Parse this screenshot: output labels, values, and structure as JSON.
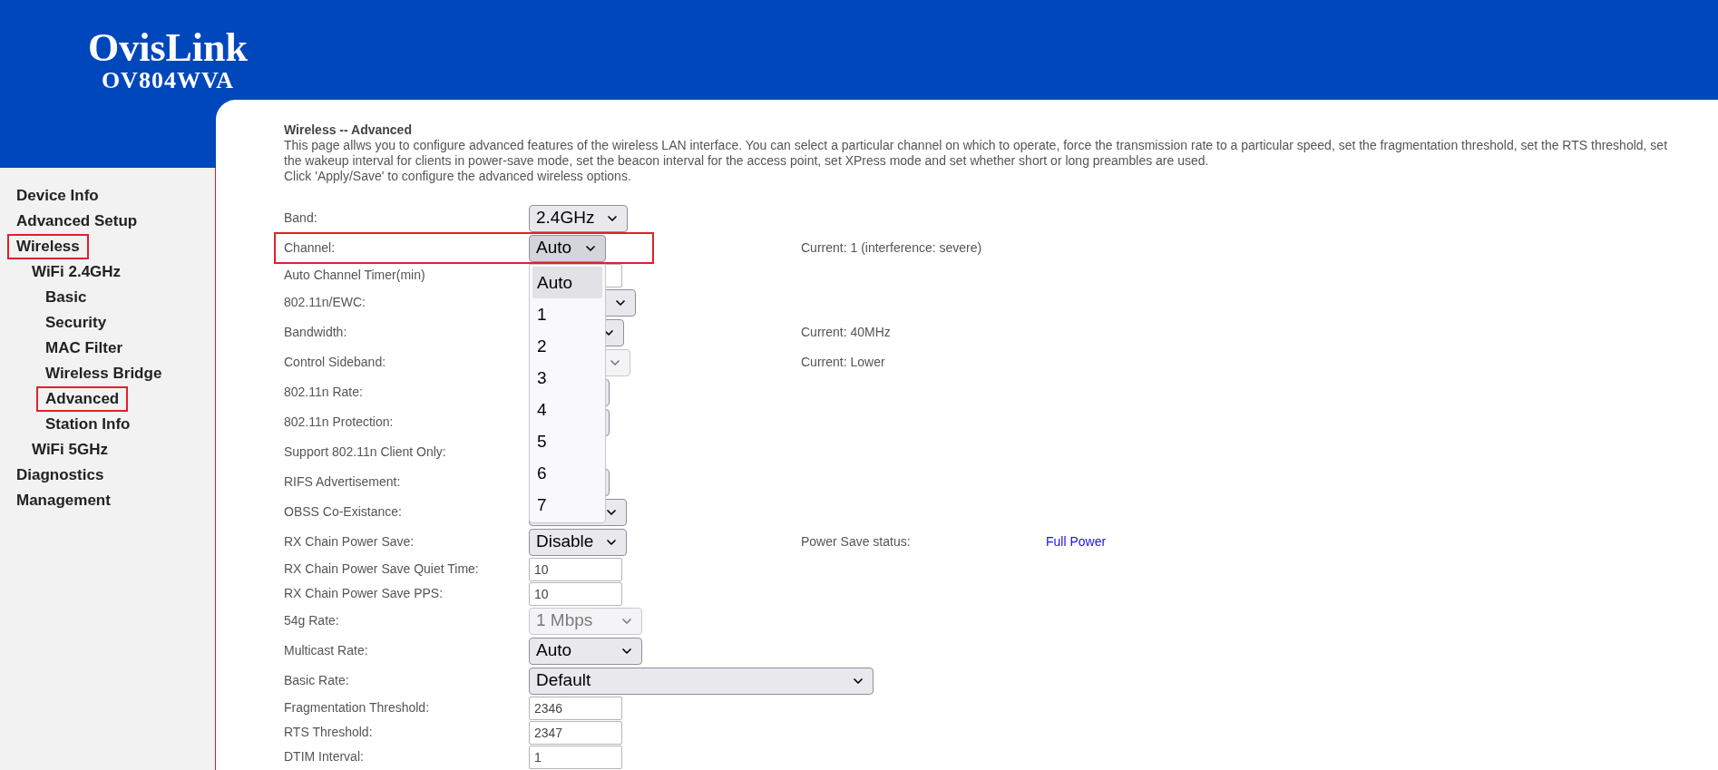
{
  "logo": {
    "brand": "OvisLink",
    "model": "OV804WVA"
  },
  "sidebar": {
    "items": [
      {
        "label": "Device Info",
        "highlighted": false
      },
      {
        "label": "Advanced Setup",
        "highlighted": false
      },
      {
        "label": "Wireless",
        "highlighted": true,
        "children": [
          {
            "label": "WiFi 2.4GHz",
            "highlighted": false,
            "children": [
              {
                "label": "Basic",
                "highlighted": false
              },
              {
                "label": "Security",
                "highlighted": false
              },
              {
                "label": "MAC Filter",
                "highlighted": false
              },
              {
                "label": "Wireless Bridge",
                "highlighted": false
              },
              {
                "label": "Advanced",
                "highlighted": true
              },
              {
                "label": "Station Info",
                "highlighted": false
              }
            ]
          },
          {
            "label": "WiFi 5GHz",
            "highlighted": false
          }
        ]
      },
      {
        "label": "Diagnostics",
        "highlighted": false
      },
      {
        "label": "Management",
        "highlighted": false
      }
    ]
  },
  "page": {
    "title": "Wireless -- Advanced",
    "description": "This page allws you to configure advanced features of the wireless LAN interface. You can select a particular channel on which to operate, force the transmission rate to a particular speed, set the fragmentation threshold, set the RTS threshold, set the wakeup interval for clients in power-save mode, set the beacon interval for the access point, set XPress mode and set whether short or long preambles are used.",
    "instruction": "Click 'Apply/Save' to configure the advanced wireless options."
  },
  "form": {
    "rows": [
      {
        "label": "Band:",
        "highlighted": false,
        "control": {
          "kind": "select",
          "value": "2.4GHz",
          "disabled": false
        }
      },
      {
        "label": "Channel:",
        "highlighted": true,
        "control": {
          "kind": "select",
          "value": "Auto",
          "disabled": false,
          "open": true,
          "options": [
            {
              "label": "Auto",
              "selected": true
            },
            {
              "label": "1",
              "selected": false
            },
            {
              "label": "2",
              "selected": false
            },
            {
              "label": "3",
              "selected": false
            },
            {
              "label": "4",
              "selected": false
            },
            {
              "label": "5",
              "selected": false
            },
            {
              "label": "6",
              "selected": false
            },
            {
              "label": "7",
              "selected": false
            }
          ]
        },
        "status": "Current: 1 (interference: severe)"
      },
      {
        "label": "Auto Channel Timer(min)",
        "highlighted": false,
        "control": {
          "kind": "input"
        }
      },
      {
        "label": "802.11n/EWC:",
        "highlighted": false,
        "control": {
          "kind": "select",
          "disabled": false
        }
      },
      {
        "label": "Bandwidth:",
        "highlighted": false,
        "control": {
          "kind": "select",
          "disabled": false
        },
        "status": "Current: 40MHz"
      },
      {
        "label": "Control Sideband:",
        "highlighted": false,
        "control": {
          "kind": "select",
          "disabled": true
        },
        "status": "Current: Lower"
      },
      {
        "label": "802.11n Rate:",
        "highlighted": false,
        "control": {
          "kind": "select"
        }
      },
      {
        "label": "802.11n Protection:",
        "highlighted": false,
        "control": {
          "kind": "select"
        }
      },
      {
        "label": "Support 802.11n Client Only:",
        "highlighted": false
      },
      {
        "label": "RIFS Advertisement:",
        "highlighted": false,
        "control": {
          "kind": "select"
        }
      },
      {
        "label": "OBSS Co-Existance:",
        "highlighted": false,
        "control": {
          "kind": "select",
          "disabled": false
        }
      },
      {
        "label": "RX Chain Power Save:",
        "highlighted": false,
        "control": {
          "kind": "select",
          "value": "Disable",
          "disabled": false
        },
        "status": "Power Save status:",
        "status_value": "Full Power"
      },
      {
        "label": "RX Chain Power Save Quiet Time:",
        "highlighted": false,
        "control": {
          "kind": "input",
          "value": "10"
        }
      },
      {
        "label": "RX Chain Power Save PPS:",
        "highlighted": false,
        "control": {
          "kind": "input",
          "value": "10"
        }
      },
      {
        "label": "54g Rate:",
        "highlighted": false,
        "control": {
          "kind": "select",
          "value": "1 Mbps",
          "disabled": true
        }
      },
      {
        "label": "Multicast Rate:",
        "highlighted": false,
        "control": {
          "kind": "select",
          "value": "Auto",
          "disabled": false
        }
      },
      {
        "label": "Basic Rate:",
        "highlighted": false,
        "control": {
          "kind": "select",
          "value": "Default",
          "disabled": false
        }
      },
      {
        "label": "Fragmentation Threshold:",
        "highlighted": false,
        "control": {
          "kind": "input",
          "value": "2346"
        }
      },
      {
        "label": "RTS Threshold:",
        "highlighted": false,
        "control": {
          "kind": "input",
          "value": "2347"
        }
      },
      {
        "label": "DTIM Interval:",
        "highlighted": false,
        "control": {
          "kind": "input",
          "value": "1"
        }
      }
    ]
  }
}
